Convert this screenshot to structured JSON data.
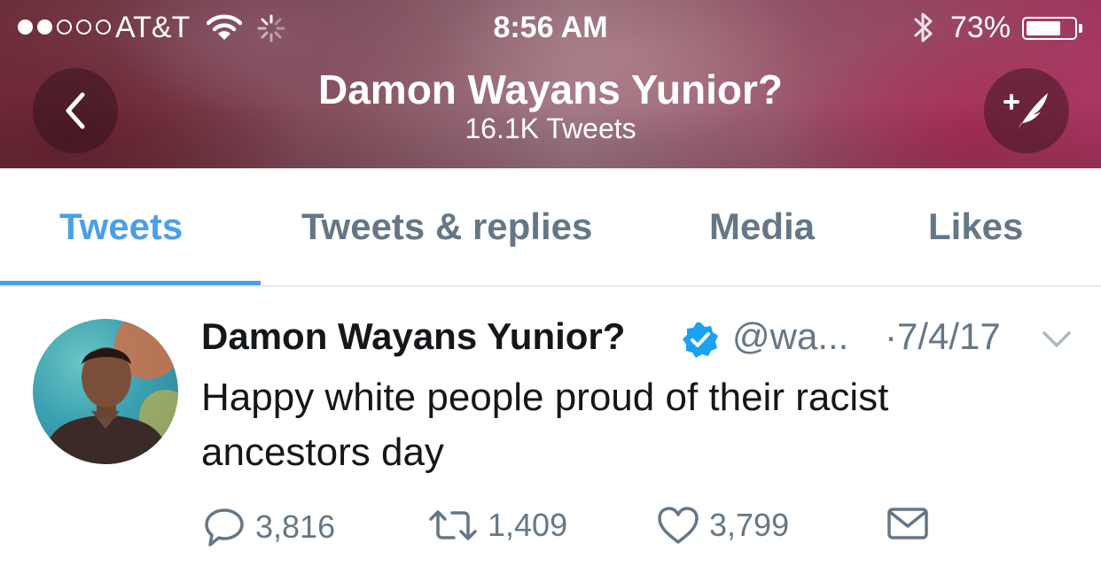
{
  "status_bar": {
    "carrier": "AT&T",
    "time": "8:56 AM",
    "battery_percent": "73%",
    "battery_level": 0.73,
    "signal_bars_filled": 2,
    "signal_bars_total": 5
  },
  "header": {
    "title": "Damon Wayans Yunior?",
    "subtitle": "16.1K Tweets"
  },
  "tabs": [
    {
      "label": "Tweets",
      "active": true
    },
    {
      "label": "Tweets & replies",
      "active": false
    },
    {
      "label": "Media",
      "active": false
    },
    {
      "label": "Likes",
      "active": false
    }
  ],
  "tweet": {
    "author_name": "Damon Wayans Yunior?",
    "handle": "@wa...",
    "date": "·7/4/17",
    "text": "Happy white people proud of their racist ancestors day",
    "replies": "3,816",
    "retweets": "1,409",
    "likes": "3,799"
  },
  "colors": {
    "accent": "#4aa0e6",
    "muted": "#657786",
    "text": "#14171a",
    "verified": "#1da1f2"
  },
  "icons": [
    "back-arrow-icon",
    "compose-tweet-icon",
    "verified-badge-icon",
    "chevron-down-icon",
    "reply-icon",
    "retweet-icon",
    "like-icon",
    "message-icon",
    "wifi-icon",
    "bluetooth-icon",
    "battery-icon",
    "activity-spinner-icon"
  ]
}
